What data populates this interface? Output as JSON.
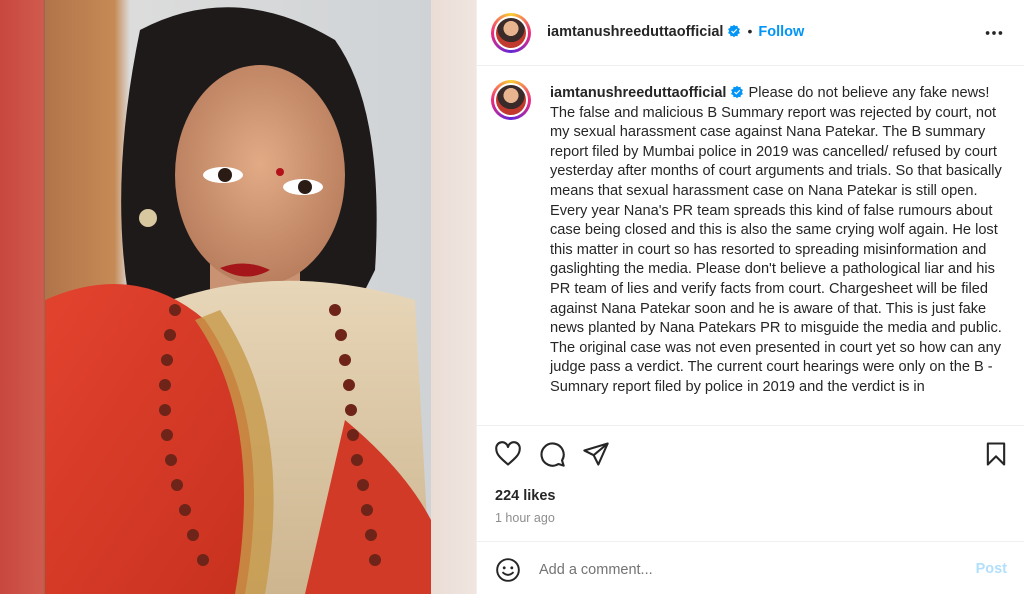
{
  "post": {
    "username": "iamtanushreeduttaofficial",
    "follow_label": "Follow",
    "separator": "•",
    "caption": "Please do not believe any fake news! The false and malicious B Summary report was rejected by court, not my sexual harassment case against Nana Patekar. The B summary report filed by Mumbai police in 2019 was cancelled/ refused by court yesterday after months of court arguments and trials. So that basically means that sexual harassment case on Nana Patekar is still open. Every year Nana's PR team spreads this kind of false rumours about case being closed and this is also the same crying wolf again. He lost this matter in court so has resorted to spreading misinformation and gaslighting the media. Please don't believe a pathological liar and his PR team of lies and verify facts from court. Chargesheet will be filed against Nana Patekar soon and he is aware of that. This is just fake news planted by Nana Patekars PR to misguide the media and public. The original case was not even presented in court yet so how can any judge pass a verdict. The current court hearings were only on the B -Sumnary report filed by police in 2019 and the verdict is in",
    "likes": "224 likes",
    "time": "1 hour ago"
  },
  "comment": {
    "placeholder": "Add a comment...",
    "post_label": "Post"
  },
  "icons": {
    "verified": "verified-badge-icon",
    "more": "more-options-icon",
    "like": "heart-icon",
    "comment": "comment-icon",
    "share": "share-icon",
    "save": "bookmark-icon",
    "emoji": "emoji-icon"
  },
  "colors": {
    "accent": "#0095f6",
    "post_disabled": "#b2dffc",
    "muted": "#8e8e8e"
  }
}
